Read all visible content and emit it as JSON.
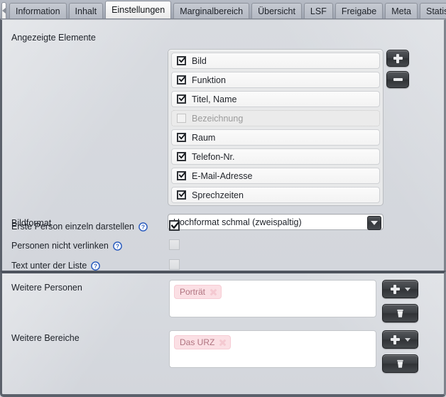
{
  "tabbar": {
    "nav_back_icon": "chevron-left-icon",
    "tabs": [
      {
        "label": "Information",
        "active": false
      },
      {
        "label": "Inhalt",
        "active": false
      },
      {
        "label": "Einstellungen",
        "active": true
      },
      {
        "label": "Marginalbereich",
        "active": false
      },
      {
        "label": "Übersicht",
        "active": false
      },
      {
        "label": "LSF",
        "active": false
      },
      {
        "label": "Freigabe",
        "active": false
      },
      {
        "label": "Meta",
        "active": false
      },
      {
        "label": "Statistik",
        "active": false
      }
    ]
  },
  "settings": {
    "displayed_elements_label": "Angezeigte Elemente",
    "items": [
      {
        "label": "Bild",
        "checked": true,
        "enabled": true
      },
      {
        "label": "Funktion",
        "checked": true,
        "enabled": true
      },
      {
        "label": "Titel, Name",
        "checked": true,
        "enabled": true
      },
      {
        "label": "Bezeichnung",
        "checked": false,
        "enabled": false
      },
      {
        "label": "Raum",
        "checked": true,
        "enabled": true
      },
      {
        "label": "Telefon-Nr.",
        "checked": true,
        "enabled": true
      },
      {
        "label": "E-Mail-Adresse",
        "checked": true,
        "enabled": true
      },
      {
        "label": "Sprechzeiten",
        "checked": true,
        "enabled": true
      }
    ],
    "add_button_icon": "plus-icon",
    "remove_button_icon": "minus-icon",
    "image_format_label": "Bildformat",
    "image_format_value": "Hochformat schmal (zweispaltig)",
    "image_format_options": [
      "Hochformat schmal (zweispaltig)"
    ],
    "options": [
      {
        "label": "Erste Person einzeln darstellen",
        "checked": true,
        "help": "?"
      },
      {
        "label": "Personen nicht verlinken",
        "checked": false,
        "help": "?"
      },
      {
        "label": "Text unter der Liste",
        "checked": false,
        "help": "?"
      }
    ]
  },
  "more": {
    "persons_label": "Weitere Personen",
    "persons_tags": [
      "Porträt"
    ],
    "areas_label": "Weitere Bereiche",
    "areas_tags": [
      "Das URZ"
    ],
    "add_icon": "plus-icon",
    "dropdown_icon": "chevron-down-icon",
    "delete_icon": "trash-icon",
    "remove_tag_icon": "close-icon"
  },
  "colors": {
    "tab_active_bg": "#f6f6f6",
    "tabbar_bg": "#aab0bb",
    "panel_bg": "#d5d8de",
    "tag_bg": "#fbdfe4",
    "tag_text": "#b07480",
    "help_blue": "#2f5fbf",
    "dark_button": "#3c3f43"
  }
}
